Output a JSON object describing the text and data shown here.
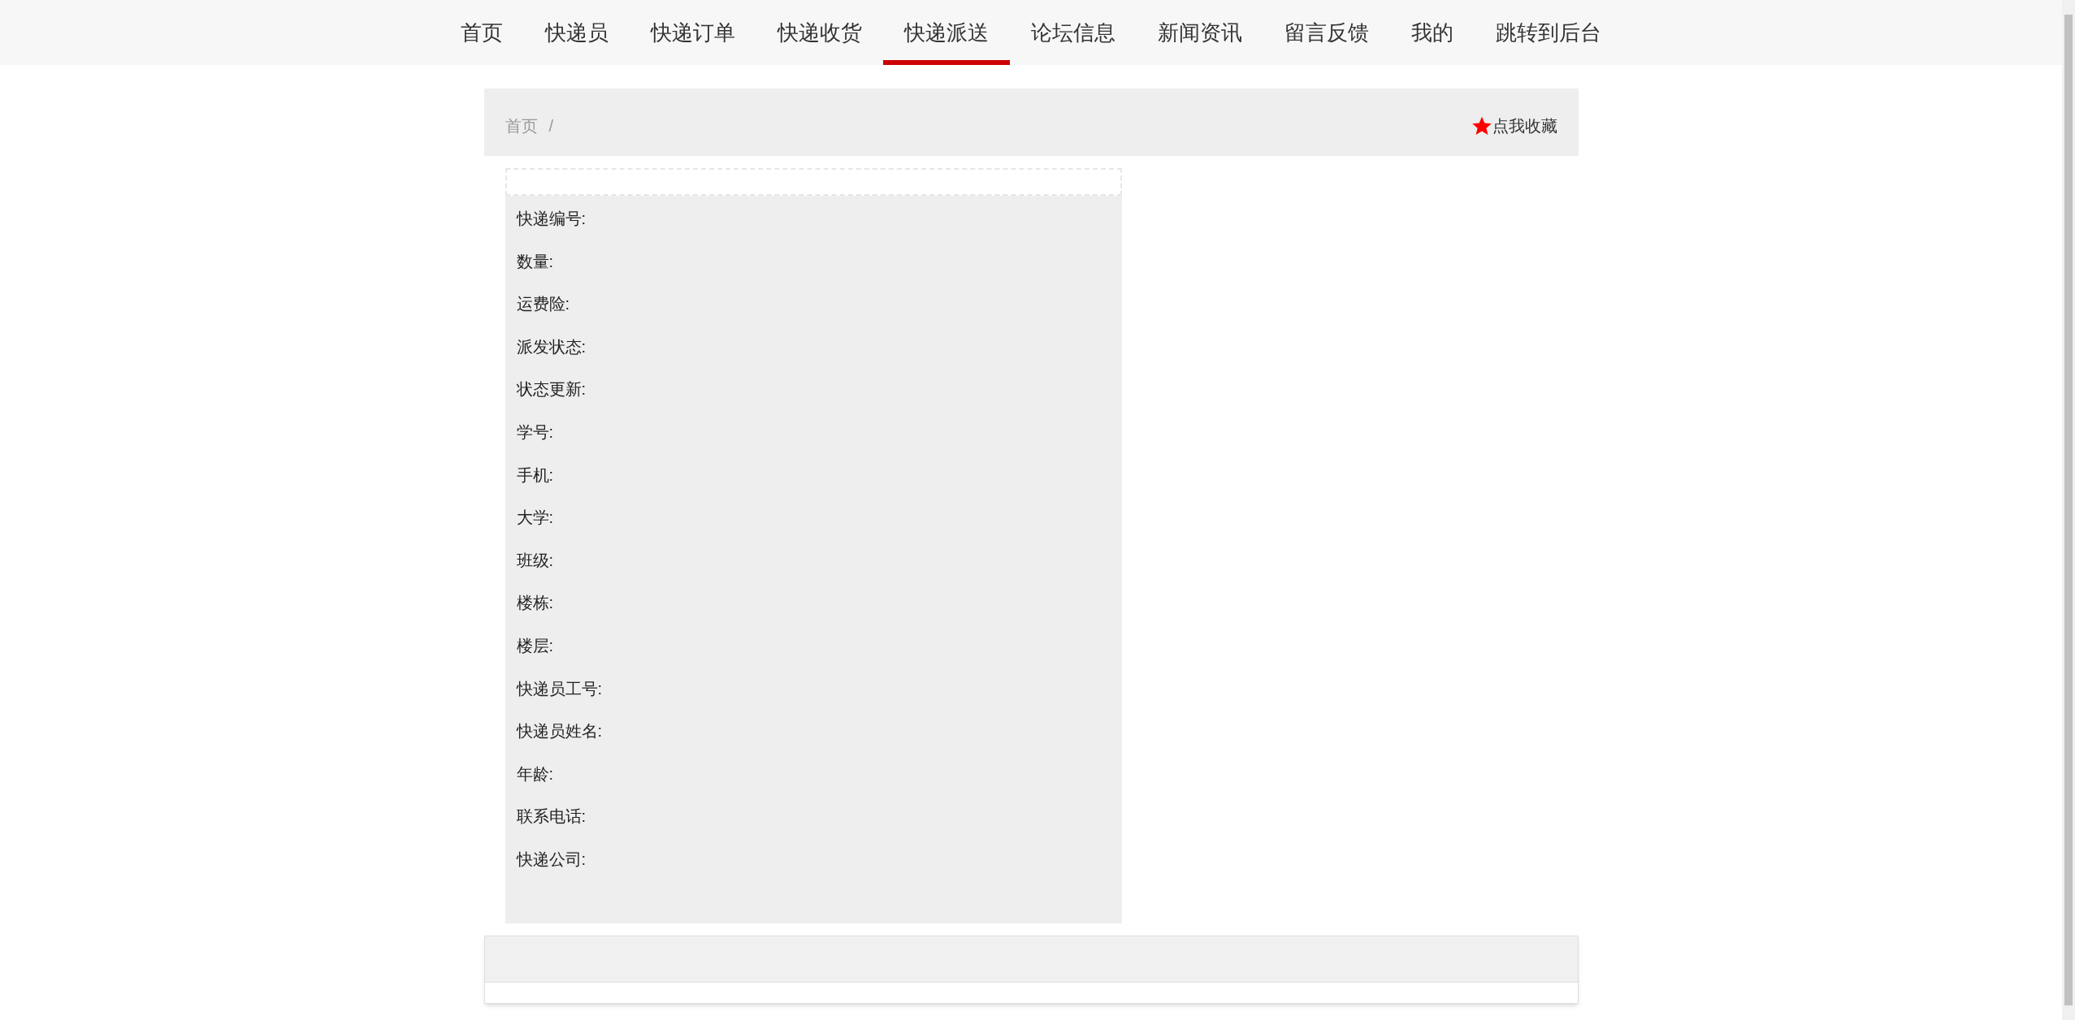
{
  "nav": [
    {
      "label": "首页",
      "selected": false
    },
    {
      "label": "快递员",
      "selected": false
    },
    {
      "label": "快递订单",
      "selected": false
    },
    {
      "label": "快递收货",
      "selected": false
    },
    {
      "label": "快递派送",
      "selected": true
    },
    {
      "label": "论坛信息",
      "selected": false
    },
    {
      "label": "新闻资讯",
      "selected": false
    },
    {
      "label": "留言反馈",
      "selected": false
    },
    {
      "label": "我的",
      "selected": false
    },
    {
      "label": "跳转到后台",
      "selected": false
    }
  ],
  "breadcrumb": {
    "items": [
      "首页"
    ],
    "separator": "/"
  },
  "favorite": {
    "label": "点我收藏"
  },
  "details": [
    "快递编号:",
    "数量:",
    "运费险:",
    "派发状态:",
    "状态更新:",
    "学号:",
    "手机:",
    "大学:",
    "班级:",
    "楼栋:",
    "楼层:",
    "快递员工号:",
    "快递员姓名:",
    "年龄:",
    "联系电话:",
    "快递公司:"
  ]
}
